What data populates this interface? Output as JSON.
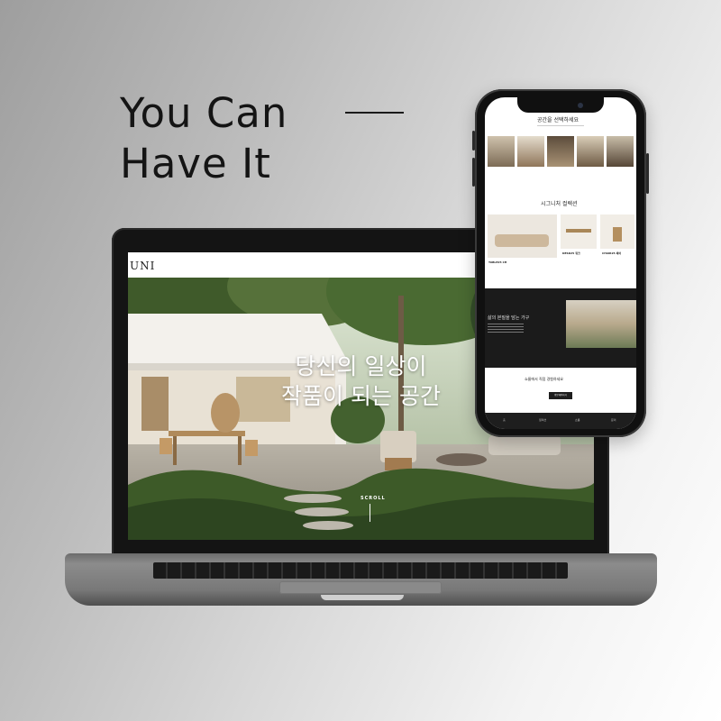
{
  "headline": {
    "line1": "You Can",
    "line2": "Have It"
  },
  "laptop": {
    "logo": "UNI",
    "hero_line1": "당신의 일상이",
    "hero_line2": "작품이 되는 공간",
    "scroll_label": "SCROLL"
  },
  "phone": {
    "section1_title": "공간을 선택하세요",
    "section2_title": "시그니처 컬렉션",
    "product1": "TABLE25 CH",
    "product2": "DESK25 워크",
    "product3": "CHAIR25 체어",
    "dark_title": "삶의 본질을 담는 가구",
    "cta_title": "쇼룸에서 직접 경험하세요",
    "cta_button": "방문예약하기",
    "tabs": [
      "홈",
      "컬렉션",
      "쇼룸",
      "문의"
    ]
  },
  "colors": {
    "ink": "#141414",
    "device": "#141414",
    "screen": "#ffffff",
    "dark_section": "#1b1b1b"
  },
  "icons": [
    "camera-icon"
  ]
}
